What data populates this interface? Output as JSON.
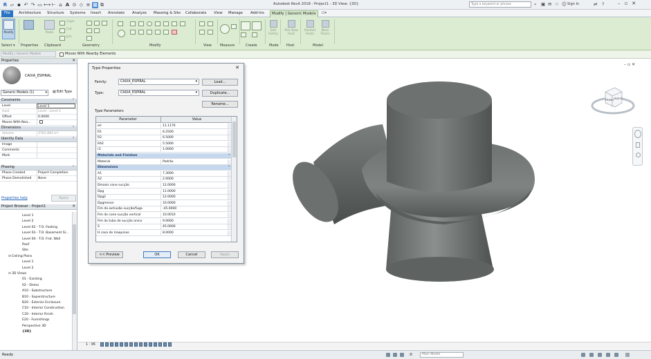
{
  "app": {
    "title": "Autodesk Revit 2018 - Project1 - 3D View: {3D}",
    "search_placeholder": "Type a keyword or phrase",
    "sign_in": "Sign In"
  },
  "menu_tabs": [
    "File",
    "Architecture",
    "Structure",
    "Systems",
    "Insert",
    "Annotate",
    "Analyze",
    "Massing & Site",
    "Collaborate",
    "View",
    "Manage",
    "Add-Ins",
    "Modify | Generic Models"
  ],
  "ribbon": {
    "modify_label": "Modify",
    "panels": [
      "Select ▾",
      "Properties",
      "Clipboard",
      "Geometry",
      "Modify",
      "View",
      "Measure",
      "Create",
      "Mode",
      "Host",
      "Model"
    ],
    "clipboard": {
      "paste": "Paste",
      "cope": "Cope",
      "cut": "Cut",
      "join": "Join"
    },
    "mode_items": [
      "Edit Family",
      "Pick New Host",
      "Related Hosts",
      "Mass Floors"
    ]
  },
  "options_bar": {
    "context": "Modify | Generic Models",
    "checkbox_label": "Moves With Nearby Elements"
  },
  "properties": {
    "title": "Properties",
    "type_name": "CAIXA_ESPIRAL",
    "selector": "Generic Models (1)",
    "edit_type": "Edit Type",
    "groups": {
      "constraints": "Constraints",
      "dimensions": "Dimensions",
      "identity": "Identity Data",
      "phasing": "Phasing"
    },
    "constraints": [
      {
        "k": "Level",
        "v": "Level 1"
      },
      {
        "k": "Host",
        "v": "Level : Level 1"
      },
      {
        "k": "Offset",
        "v": "0.0000"
      },
      {
        "k": "Moves With Nea...",
        "v": ""
      }
    ],
    "dimensions": [
      {
        "k": "Volume",
        "v": "3781.883 m³"
      }
    ],
    "identity": [
      {
        "k": "Image",
        "v": ""
      },
      {
        "k": "Comments",
        "v": ""
      },
      {
        "k": "Mark",
        "v": ""
      }
    ],
    "phasing": [
      {
        "k": "Phase Created",
        "v": "Project Completion"
      },
      {
        "k": "Phase Demolished",
        "v": "None"
      }
    ],
    "help": "Properties help",
    "apply": "Apply"
  },
  "browser": {
    "title": "Project Browser - Project1",
    "items": [
      {
        "t": "",
        "l": "Level 1"
      },
      {
        "t": "",
        "l": "Level 2"
      },
      {
        "t": "",
        "l": "Level 02 - T.O. Footing"
      },
      {
        "t": "",
        "l": "Level 03 - T.O. Basement Sl..."
      },
      {
        "t": "",
        "l": "Level 04 - T.O. Fnd. Wall"
      },
      {
        "t": "",
        "l": "Roof"
      },
      {
        "t": "",
        "l": "Site"
      },
      {
        "t": "⊟",
        "l": "Ceiling Plans"
      },
      {
        "t": "",
        "l": "Level 1"
      },
      {
        "t": "",
        "l": "Level 2"
      },
      {
        "t": "⊟",
        "l": "3D Views"
      },
      {
        "t": "",
        "l": "01 - Existing"
      },
      {
        "t": "",
        "l": "02 - Demo"
      },
      {
        "t": "",
        "l": "A10 - Substructure"
      },
      {
        "t": "",
        "l": "B10 - Superstructure"
      },
      {
        "t": "",
        "l": "B20 - Exterior Enclosure"
      },
      {
        "t": "",
        "l": "C10 - Interior Construction"
      },
      {
        "t": "",
        "l": "C20 - Interior Finish"
      },
      {
        "t": "",
        "l": "E20 - Furnishings"
      },
      {
        "t": "",
        "l": "Perspective 3D"
      },
      {
        "t": "",
        "l": "{3D}"
      }
    ]
  },
  "dialog": {
    "title": "Type Properties",
    "family_label": "Family:",
    "family_value": "CAIXA_ESPIRAL",
    "type_label": "Type:",
    "type_value": "CAIXA_ESPIRAL",
    "load": "Load...",
    "duplicate": "Duplicate...",
    "rename": "Rename...",
    "type_params": "Type Parameters",
    "col_param": "Parameter",
    "col_value": "Value",
    "rows": [
      {
        "g": false,
        "p": "e/r",
        "v": "11.1176"
      },
      {
        "g": false,
        "p": "R1",
        "v": "6.2500"
      },
      {
        "g": false,
        "p": "R2",
        "v": "6.5000"
      },
      {
        "g": false,
        "p": "RA2",
        "v": "5.5000"
      },
      {
        "g": false,
        "p": "r2",
        "v": "1.0000"
      },
      {
        "g": true,
        "p": "Materials and Finishes",
        "v": ""
      },
      {
        "g": false,
        "p": "Material",
        "v": "Padrão"
      },
      {
        "g": true,
        "p": "Dimensions",
        "v": ""
      },
      {
        "g": false,
        "p": "A1",
        "v": "7.3000"
      },
      {
        "g": false,
        "p": "A2",
        "v": "2.0000"
      },
      {
        "g": false,
        "p": "Dmaior cone sucção",
        "v": "12.0000"
      },
      {
        "g": false,
        "p": "Dpg",
        "v": "11.0000"
      },
      {
        "g": false,
        "p": "Dpg2",
        "v": "12.0000"
      },
      {
        "g": false,
        "p": "Dpgmenor",
        "v": "10.0000"
      },
      {
        "g": false,
        "p": "Fim da extrusão sucção/fuga",
        "v": "-45.0000"
      },
      {
        "g": false,
        "p": "Fim do cone sucção vertical",
        "v": "10.0010"
      },
      {
        "g": false,
        "p": "Fim do tubo de sucção único",
        "v": "9.0000"
      },
      {
        "g": false,
        "p": "S",
        "v": "45.0000"
      },
      {
        "g": false,
        "p": "H casa de maquinas",
        "v": "8.0000"
      }
    ],
    "preview": "<< Preview",
    "ok": "OK",
    "cancel": "Cancel",
    "apply": "Apply"
  },
  "viewcube": {
    "front": "FRONT",
    "right": "RIGHT"
  },
  "view_bar": {
    "scale": "1 : 96"
  },
  "status": {
    "text": "Ready",
    "zero": ":0",
    "model": "Main Model"
  },
  "colors": {
    "ribbon": "#dcecd2",
    "file_tab": "#2a74c4",
    "model_gray": "#6f7372"
  }
}
